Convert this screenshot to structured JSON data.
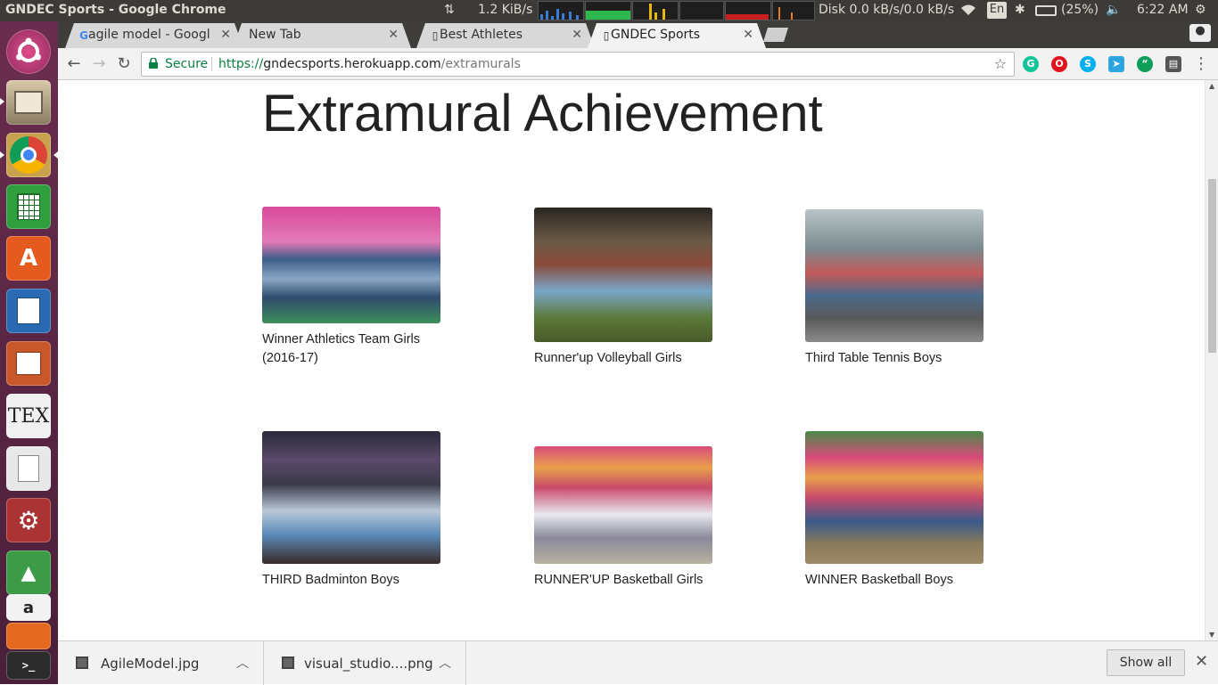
{
  "system": {
    "window_title": "GNDEC Sports - Google Chrome",
    "net_rate": "1.2 KiB/s",
    "disk": "Disk 0.0 kB/s/0.0 kB/s",
    "keyboard": "En",
    "battery": "(25%)",
    "clock": "6:22 AM"
  },
  "launcher": {
    "items": [
      "ubuntu-dash",
      "files",
      "chrome",
      "calc",
      "software-center",
      "writer",
      "impress",
      "texmaker",
      "text-editor",
      "system-settings",
      "android-studio",
      "amazon",
      "system-monitor",
      "terminal"
    ],
    "tex_label": "TEX"
  },
  "tabs": [
    {
      "label": "agile model - Googl",
      "icon": "google-icon",
      "active": false
    },
    {
      "label": "New Tab",
      "icon": "none",
      "active": false
    },
    {
      "label": "Best Athletes",
      "icon": "page-icon",
      "active": false
    },
    {
      "label": "GNDEC Sports",
      "icon": "page-icon",
      "active": true
    }
  ],
  "toolbar": {
    "secure_label": "Secure",
    "url_scheme": "https://",
    "url_host": "gndecsports.herokuapp.com",
    "url_path": "/extramurals",
    "extensions": [
      "grammarly-icon",
      "opera-icon",
      "skype-icon",
      "telegram-icon",
      "hangouts-icon",
      "clipboard-icon"
    ]
  },
  "page": {
    "title": "Extramural Achievement",
    "cards": [
      {
        "caption": "Winner Athletics Team Girls (2016-17)"
      },
      {
        "caption": "Runner'up Volleyball Girls"
      },
      {
        "caption": "Third Table Tennis Boys"
      },
      {
        "caption": "THIRD Badminton Boys"
      },
      {
        "caption": "RUNNER'UP Basketball Girls"
      },
      {
        "caption": "WINNER Basketball Boys"
      }
    ]
  },
  "downloads": {
    "items": [
      {
        "filename": "AgileModel.jpg"
      },
      {
        "filename": "visual_studio....png"
      }
    ],
    "show_all_label": "Show all"
  },
  "colors": {
    "panel": "#3c3b37",
    "launcher": "#5e2750",
    "secure_green": "#0b8043",
    "tab_active": "#f2f2f2"
  }
}
